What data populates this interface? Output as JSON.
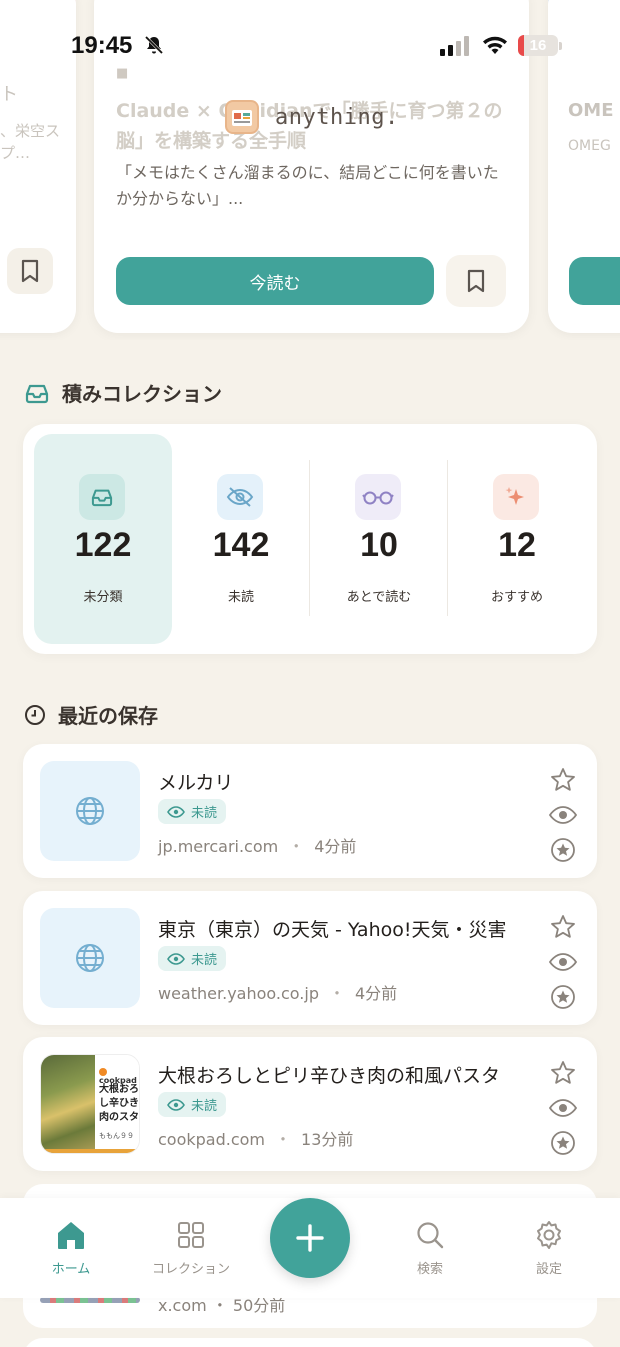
{
  "status_bar": {
    "time": "19:45",
    "battery_level": "16"
  },
  "app": {
    "name": "anything."
  },
  "featured": {
    "title": "Claude × Obsidianで「勝手に育つ第２の脳」を構築する全手順",
    "description": "「メモはたくさん溜まるのに、結局どこに何を書いたか分からない」...",
    "read_now_label": "今読む",
    "left_card_title": "ト",
    "left_card_desc": "、栄空スプ…",
    "right_card_title": "OME",
    "right_card_desc": "OMEG"
  },
  "collections": {
    "heading": "積みコレクション",
    "items": [
      {
        "count": "122",
        "label": "未分類"
      },
      {
        "count": "142",
        "label": "未読"
      },
      {
        "count": "10",
        "label": "あとで読む"
      },
      {
        "count": "12",
        "label": "おすすめ"
      }
    ]
  },
  "recent": {
    "heading": "最近の保存",
    "unread_label": "未読",
    "items": [
      {
        "title": "メルカリ",
        "domain": "jp.mercari.com",
        "time": "4分前"
      },
      {
        "title": "東京（東京）の天気 - Yahoo!天気・災害",
        "domain": "weather.yahoo.co.jp",
        "time": "4分前"
      },
      {
        "title": "大根おろしとピリ辛ひき肉の和風パスタ",
        "domain": "cookpad.com",
        "time": "13分前"
      }
    ],
    "peek_meta": "x.com ・ 50分前"
  },
  "cookpad_thumb": {
    "brand": "cookpad",
    "text": "大根おろし辛ひき肉のスタ",
    "author": "ももん９９"
  },
  "tabbar": {
    "home": "ホーム",
    "collections": "コレクション",
    "search": "検索",
    "settings": "設定"
  },
  "colors": {
    "accent": "#41a39a",
    "background": "#f6f2ea",
    "card": "#ffffff"
  }
}
